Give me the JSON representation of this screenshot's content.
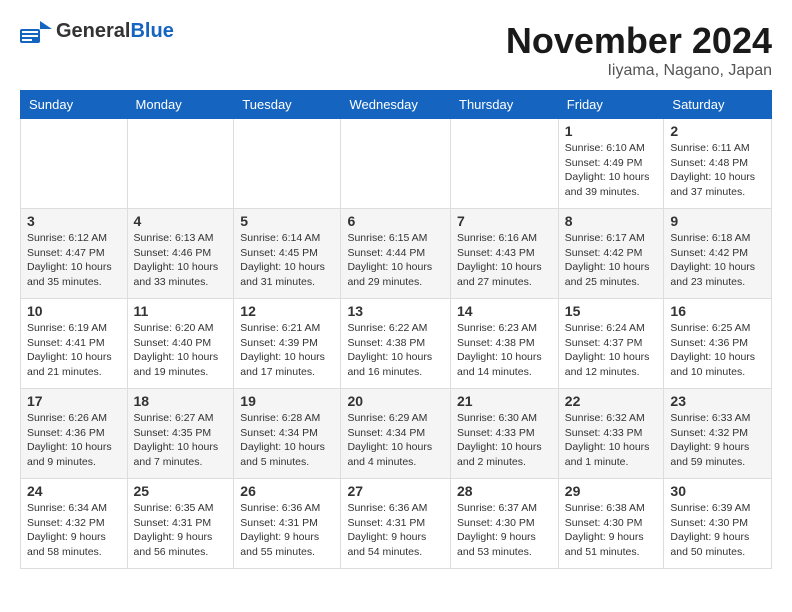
{
  "logo": {
    "general": "General",
    "blue": "Blue"
  },
  "title": "November 2024",
  "subtitle": "Iiyama, Nagano, Japan",
  "headers": [
    "Sunday",
    "Monday",
    "Tuesday",
    "Wednesday",
    "Thursday",
    "Friday",
    "Saturday"
  ],
  "weeks": [
    [
      {
        "day": "",
        "content": ""
      },
      {
        "day": "",
        "content": ""
      },
      {
        "day": "",
        "content": ""
      },
      {
        "day": "",
        "content": ""
      },
      {
        "day": "",
        "content": ""
      },
      {
        "day": "1",
        "content": "Sunrise: 6:10 AM\nSunset: 4:49 PM\nDaylight: 10 hours and 39 minutes."
      },
      {
        "day": "2",
        "content": "Sunrise: 6:11 AM\nSunset: 4:48 PM\nDaylight: 10 hours and 37 minutes."
      }
    ],
    [
      {
        "day": "3",
        "content": "Sunrise: 6:12 AM\nSunset: 4:47 PM\nDaylight: 10 hours and 35 minutes."
      },
      {
        "day": "4",
        "content": "Sunrise: 6:13 AM\nSunset: 4:46 PM\nDaylight: 10 hours and 33 minutes."
      },
      {
        "day": "5",
        "content": "Sunrise: 6:14 AM\nSunset: 4:45 PM\nDaylight: 10 hours and 31 minutes."
      },
      {
        "day": "6",
        "content": "Sunrise: 6:15 AM\nSunset: 4:44 PM\nDaylight: 10 hours and 29 minutes."
      },
      {
        "day": "7",
        "content": "Sunrise: 6:16 AM\nSunset: 4:43 PM\nDaylight: 10 hours and 27 minutes."
      },
      {
        "day": "8",
        "content": "Sunrise: 6:17 AM\nSunset: 4:42 PM\nDaylight: 10 hours and 25 minutes."
      },
      {
        "day": "9",
        "content": "Sunrise: 6:18 AM\nSunset: 4:42 PM\nDaylight: 10 hours and 23 minutes."
      }
    ],
    [
      {
        "day": "10",
        "content": "Sunrise: 6:19 AM\nSunset: 4:41 PM\nDaylight: 10 hours and 21 minutes."
      },
      {
        "day": "11",
        "content": "Sunrise: 6:20 AM\nSunset: 4:40 PM\nDaylight: 10 hours and 19 minutes."
      },
      {
        "day": "12",
        "content": "Sunrise: 6:21 AM\nSunset: 4:39 PM\nDaylight: 10 hours and 17 minutes."
      },
      {
        "day": "13",
        "content": "Sunrise: 6:22 AM\nSunset: 4:38 PM\nDaylight: 10 hours and 16 minutes."
      },
      {
        "day": "14",
        "content": "Sunrise: 6:23 AM\nSunset: 4:38 PM\nDaylight: 10 hours and 14 minutes."
      },
      {
        "day": "15",
        "content": "Sunrise: 6:24 AM\nSunset: 4:37 PM\nDaylight: 10 hours and 12 minutes."
      },
      {
        "day": "16",
        "content": "Sunrise: 6:25 AM\nSunset: 4:36 PM\nDaylight: 10 hours and 10 minutes."
      }
    ],
    [
      {
        "day": "17",
        "content": "Sunrise: 6:26 AM\nSunset: 4:36 PM\nDaylight: 10 hours and 9 minutes."
      },
      {
        "day": "18",
        "content": "Sunrise: 6:27 AM\nSunset: 4:35 PM\nDaylight: 10 hours and 7 minutes."
      },
      {
        "day": "19",
        "content": "Sunrise: 6:28 AM\nSunset: 4:34 PM\nDaylight: 10 hours and 5 minutes."
      },
      {
        "day": "20",
        "content": "Sunrise: 6:29 AM\nSunset: 4:34 PM\nDaylight: 10 hours and 4 minutes."
      },
      {
        "day": "21",
        "content": "Sunrise: 6:30 AM\nSunset: 4:33 PM\nDaylight: 10 hours and 2 minutes."
      },
      {
        "day": "22",
        "content": "Sunrise: 6:32 AM\nSunset: 4:33 PM\nDaylight: 10 hours and 1 minute."
      },
      {
        "day": "23",
        "content": "Sunrise: 6:33 AM\nSunset: 4:32 PM\nDaylight: 9 hours and 59 minutes."
      }
    ],
    [
      {
        "day": "24",
        "content": "Sunrise: 6:34 AM\nSunset: 4:32 PM\nDaylight: 9 hours and 58 minutes."
      },
      {
        "day": "25",
        "content": "Sunrise: 6:35 AM\nSunset: 4:31 PM\nDaylight: 9 hours and 56 minutes."
      },
      {
        "day": "26",
        "content": "Sunrise: 6:36 AM\nSunset: 4:31 PM\nDaylight: 9 hours and 55 minutes."
      },
      {
        "day": "27",
        "content": "Sunrise: 6:36 AM\nSunset: 4:31 PM\nDaylight: 9 hours and 54 minutes."
      },
      {
        "day": "28",
        "content": "Sunrise: 6:37 AM\nSunset: 4:30 PM\nDaylight: 9 hours and 53 minutes."
      },
      {
        "day": "29",
        "content": "Sunrise: 6:38 AM\nSunset: 4:30 PM\nDaylight: 9 hours and 51 minutes."
      },
      {
        "day": "30",
        "content": "Sunrise: 6:39 AM\nSunset: 4:30 PM\nDaylight: 9 hours and 50 minutes."
      }
    ]
  ]
}
